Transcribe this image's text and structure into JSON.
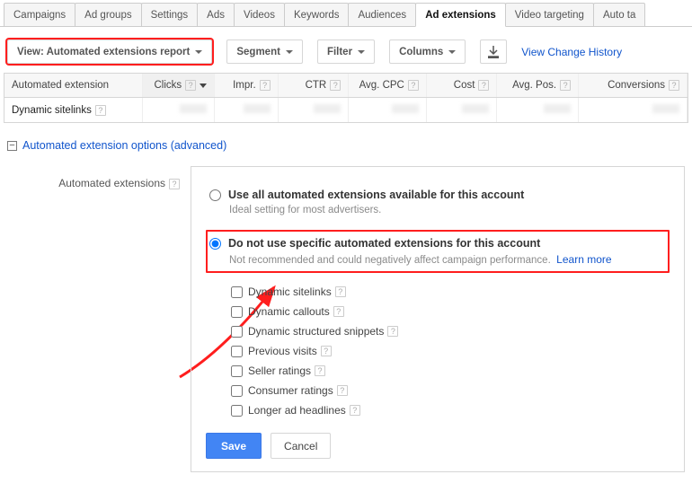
{
  "tabs": [
    "Campaigns",
    "Ad groups",
    "Settings",
    "Ads",
    "Videos",
    "Keywords",
    "Audiences",
    "Ad extensions",
    "Video targeting",
    "Auto ta"
  ],
  "active_tab": 7,
  "toolbar": {
    "view_label": "View: Automated extensions report",
    "segment": "Segment",
    "filter": "Filter",
    "columns": "Columns",
    "history_link": "View Change History"
  },
  "icons": {
    "download": "download-icon"
  },
  "table": {
    "columns": [
      "Automated extension",
      "Clicks",
      "Impr.",
      "CTR",
      "Avg. CPC",
      "Cost",
      "Avg. Pos.",
      "Conversions"
    ],
    "sort_col": 1,
    "rows": [
      {
        "label": "Dynamic sitelinks"
      }
    ]
  },
  "section": {
    "title": "Automated extension options (advanced)",
    "field_label": "Automated extensions",
    "option_a": {
      "label": "Use all automated extensions available for this account",
      "sub": "Ideal setting for most advertisers."
    },
    "option_b": {
      "label": "Do not use specific automated extensions for this account",
      "sub": "Not recommended and could negatively affect campaign performance.",
      "learn_more": "Learn more"
    },
    "checks": [
      "Dynamic sitelinks",
      "Dynamic callouts",
      "Dynamic structured snippets",
      "Previous visits",
      "Seller ratings",
      "Consumer ratings",
      "Longer ad headlines"
    ],
    "save": "Save",
    "cancel": "Cancel"
  }
}
